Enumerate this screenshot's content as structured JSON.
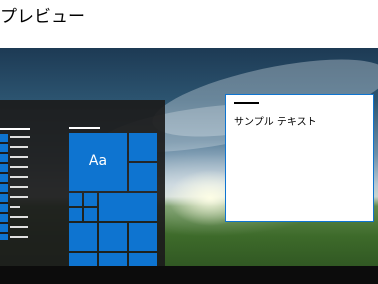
{
  "header": {
    "title": "プレビュー"
  },
  "preview": {
    "window": {
      "sample_text": "サンプル テキスト"
    },
    "start_menu": {
      "tile_text": "Aa"
    },
    "accent_color": "#0e74d0",
    "window_bg": "#ffffff",
    "start_bg": "#1c1c1c"
  }
}
